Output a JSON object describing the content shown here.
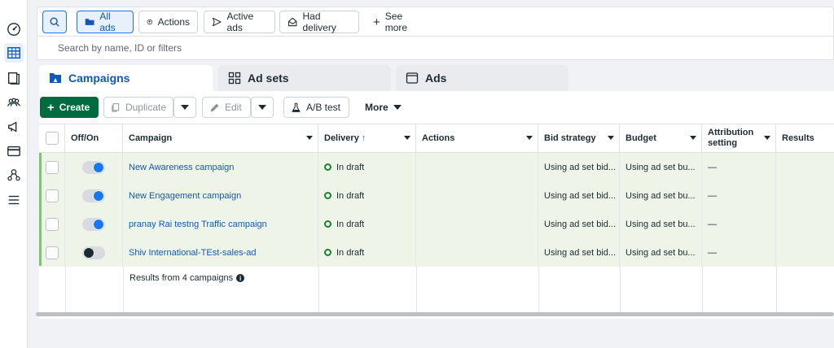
{
  "filters": {
    "all_ads": "All ads",
    "actions": "Actions",
    "active_ads": "Active ads",
    "had_delivery": "Had delivery",
    "see_more": "See more"
  },
  "search": {
    "placeholder": "Search by name, ID or filters"
  },
  "tabs": [
    {
      "label": "Campaigns"
    },
    {
      "label": "Ad sets"
    },
    {
      "label": "Ads"
    }
  ],
  "toolbar": {
    "create": "Create",
    "duplicate": "Duplicate",
    "edit": "Edit",
    "ab_test": "A/B test",
    "more": "More"
  },
  "columns": {
    "off_on": "Off/On",
    "campaign": "Campaign",
    "delivery": "Delivery",
    "delivery_sort": "↑",
    "actions": "Actions",
    "bid_strategy": "Bid strategy",
    "budget": "Budget",
    "attribution": "Attribution setting",
    "results": "Results"
  },
  "rows": [
    {
      "name": "New Awareness campaign",
      "on": true,
      "delivery": "In draft",
      "bid": "Using ad set bid...",
      "budget": "Using ad set bu...",
      "attribution": "—"
    },
    {
      "name": "New Engagement campaign",
      "on": true,
      "delivery": "In draft",
      "bid": "Using ad set bid...",
      "budget": "Using ad set bu...",
      "attribution": "—"
    },
    {
      "name": "pranay Rai testng Traffic campaign",
      "on": true,
      "delivery": "In draft",
      "bid": "Using ad set bid...",
      "budget": "Using ad set bu...",
      "attribution": "—"
    },
    {
      "name": "Shiv International-TEst-sales-ad",
      "on": false,
      "delivery": "In draft",
      "bid": "Using ad set bid...",
      "budget": "Using ad set bu...",
      "attribution": "—"
    }
  ],
  "summary": {
    "text": "Results from 4 campaigns",
    "info_glyph": "i"
  },
  "colors": {
    "accent": "#1877f2",
    "create_green": "#006b3e",
    "selected_row": "#eef5e8"
  }
}
